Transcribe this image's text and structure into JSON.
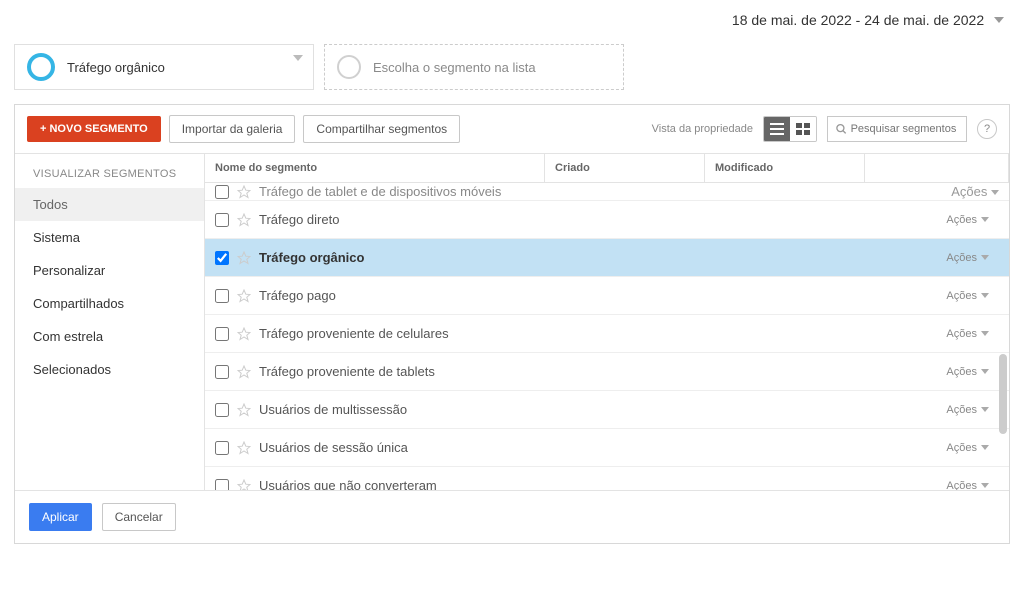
{
  "date_range": "18 de mai. de 2022 - 24 de mai. de 2022",
  "active_segment": "Tráfego orgânico",
  "placeholder_segment_text": "Escolha o segmento na lista",
  "toolbar": {
    "new_segment": "+ NOVO SEGMENTO",
    "import_gallery": "Importar da galeria",
    "share_segments": "Compartilhar segmentos",
    "view_property": "Vista da propriedade",
    "search_placeholder": "Pesquisar segmentos"
  },
  "sidebar": {
    "header": "VISUALIZAR SEGMENTOS",
    "items": [
      {
        "label": "Todos",
        "active": true
      },
      {
        "label": "Sistema",
        "active": false
      },
      {
        "label": "Personalizar",
        "active": false
      },
      {
        "label": "Compartilhados",
        "active": false
      },
      {
        "label": "Com estrela",
        "active": false
      },
      {
        "label": "Selecionados",
        "active": false
      }
    ]
  },
  "table": {
    "columns": {
      "name": "Nome do segmento",
      "created": "Criado",
      "modified": "Modificado"
    },
    "partial_top": "Tráfego de tablet e de dispositivos móveis",
    "rows": [
      {
        "name": "Tráfego direto",
        "checked": false
      },
      {
        "name": "Tráfego orgânico",
        "checked": true
      },
      {
        "name": "Tráfego pago",
        "checked": false
      },
      {
        "name": "Tráfego proveniente de celulares",
        "checked": false
      },
      {
        "name": "Tráfego proveniente de tablets",
        "checked": false
      },
      {
        "name": "Usuários de multissessão",
        "checked": false
      },
      {
        "name": "Usuários de sessão única",
        "checked": false
      },
      {
        "name": "Usuários que não converteram",
        "checked": false
      }
    ],
    "actions_label": "Ações"
  },
  "footer": {
    "apply": "Aplicar",
    "cancel": "Cancelar"
  }
}
